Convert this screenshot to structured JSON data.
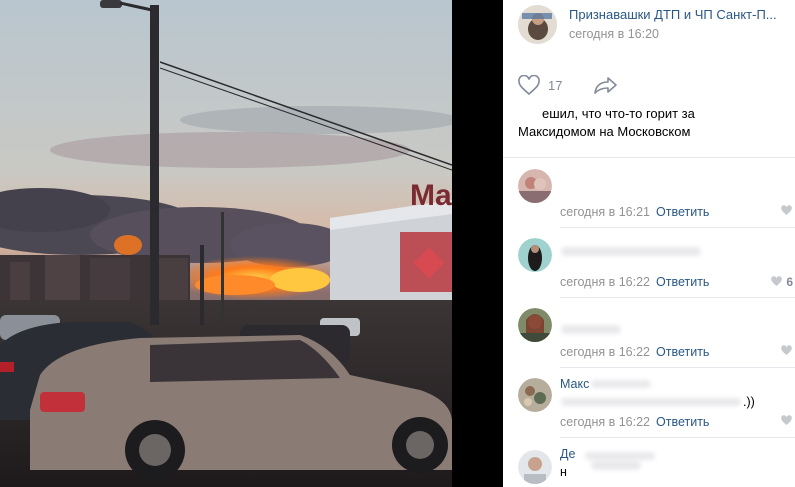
{
  "post": {
    "group_name": "Признавашки ДТП и ЧП Санкт-П...",
    "time": "сегодня в 16:20",
    "likes": "17",
    "text_line1": "ешил, что что-то горит за",
    "text_line2": "Максидомом на Московском"
  },
  "photo": {
    "sign_text": "Ma"
  },
  "comments": [
    {
      "author": "",
      "text": "",
      "time": "сегодня в 16:21",
      "reply": "Ответить",
      "likes": ""
    },
    {
      "author": "",
      "text": "",
      "time": "сегодня в 16:22",
      "reply": "Ответить",
      "likes": "6"
    },
    {
      "author": "",
      "text": "",
      "time": "сегодня в 16:22",
      "reply": "Ответить",
      "likes": ""
    },
    {
      "author": "Макс",
      "text": ".))",
      "time": "сегодня в 16:22",
      "reply": "Ответить",
      "likes": ""
    },
    {
      "author": "Де",
      "text": "н",
      "time": "",
      "reply": "",
      "likes": ""
    }
  ],
  "icons": {
    "like": "heart-icon",
    "share": "share-arrow-icon",
    "comment_like": "heart-icon"
  },
  "colors": {
    "link": "#2a5885",
    "muted": "#939393",
    "fire": "#ff7a1a"
  }
}
